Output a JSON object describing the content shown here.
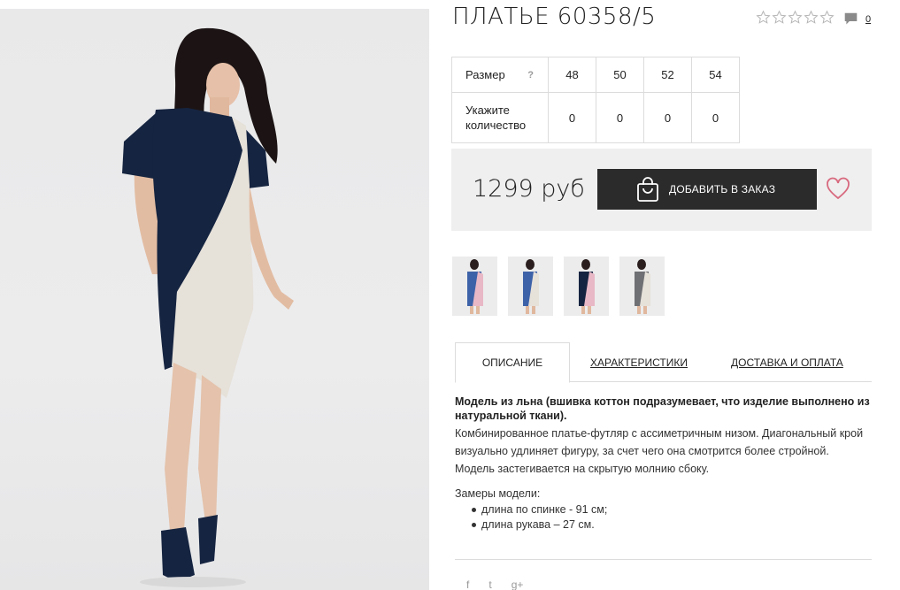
{
  "product": {
    "title": "ПЛАТЬЕ 60358/5",
    "rating_stars": 5,
    "comment_count": "0"
  },
  "sizes": {
    "size_label": "Размер",
    "help_label": "?",
    "qty_label": "Укажите количество",
    "columns": [
      "48",
      "50",
      "52",
      "54"
    ],
    "quantities": [
      "0",
      "0",
      "0",
      "0"
    ]
  },
  "purchase": {
    "price": "1299 руб",
    "add_to_order_label": "ДОБАВИТЬ В ЗАКАЗ"
  },
  "tabs": [
    {
      "label": "ОПИСАНИЕ",
      "active": true
    },
    {
      "label": "ХАРАКТЕРИСТИКИ",
      "active": false
    },
    {
      "label": "ДОСТАВКА И ОПЛАТА",
      "active": false
    }
  ],
  "description": {
    "bold": "Модель из льна (вшивка коттон подразумевает, что изделие выполнено из натуральной ткани).",
    "text": "Комбинированное платье-футляр с ассиметричным низом. Диагональный крой визуально удлиняет фигуру, за счет чего она смотрится более стройной. Модель застегивается на скрытую молнию сбоку.",
    "measures_label": "Замеры модели:",
    "measures": [
      "длина по спинке - 91 см;",
      "длина рукава – 27 см."
    ]
  },
  "social": [
    "f",
    "t",
    "g+"
  ],
  "icons": {
    "star": "star-outline-icon",
    "comment": "comment-bubble-icon",
    "bag": "shopping-bag-icon",
    "heart": "heart-outline-icon"
  },
  "colors": {
    "button_bg": "#2b2b2b",
    "price_box_bg": "#efefef",
    "heart": "#d86a7f",
    "dress_dark": "#152440",
    "dress_light": "#e6e1d9",
    "dress_blue": "#3d62a8",
    "dress_pink": "#e8b8c6",
    "dress_gray": "#6f7073"
  }
}
